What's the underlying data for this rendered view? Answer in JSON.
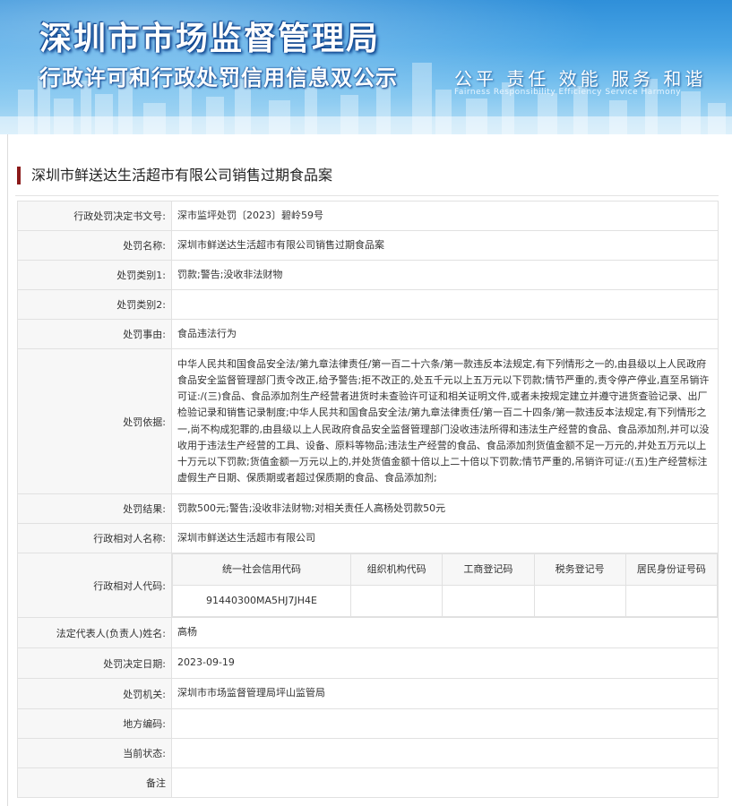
{
  "banner": {
    "title": "深圳市市场监督管理局",
    "subtitle": "行政许可和行政处罚信用信息双公示",
    "slogan": "公平 责任 效能 服务 和谐",
    "slogan_en": "Fairness Responsibility Efficiency Service Harmony"
  },
  "case_title": "深圳市鲜送达生活超市有限公司销售过期食品案",
  "rows": {
    "decision_no": {
      "label": "行政处罚决定书文号:",
      "value": "深市监坪处罚〔2023〕碧岭59号"
    },
    "penalty_name": {
      "label": "处罚名称:",
      "value": "深圳市鲜送达生活超市有限公司销售过期食品案"
    },
    "category1": {
      "label": "处罚类别1:",
      "value": "罚款;警告;没收非法财物"
    },
    "category2": {
      "label": "处罚类别2:",
      "value": ""
    },
    "reason": {
      "label": "处罚事由:",
      "value": "食品违法行为"
    },
    "basis": {
      "label": "处罚依据:",
      "value": "中华人民共和国食品安全法/第九章法律责任/第一百二十六条/第一款违反本法规定,有下列情形之一的,由县级以上人民政府食品安全监督管理部门责令改正,给予警告;拒不改正的,处五千元以上五万元以下罚款;情节严重的,责令停产停业,直至吊销许可证:/(三)食品、食品添加剂生产经营者进货时未查验许可证和相关证明文件,或者未按规定建立并遵守进货查验记录、出厂检验记录和销售记录制度;中华人民共和国食品安全法/第九章法律责任/第一百二十四条/第一款违反本法规定,有下列情形之一,尚不构成犯罪的,由县级以上人民政府食品安全监督管理部门没收违法所得和违法生产经营的食品、食品添加剂,并可以没收用于违法生产经营的工具、设备、原料等物品;违法生产经营的食品、食品添加剂货值金额不足一万元的,并处五万元以上十万元以下罚款;货值金额一万元以上的,并处货值金额十倍以上二十倍以下罚款;情节严重的,吊销许可证:/(五)生产经营标注虚假生产日期、保质期或者超过保质期的食品、食品添加剂;"
    },
    "result": {
      "label": "处罚结果:",
      "value": "罚款500元;警告;没收非法财物;对相关责任人高杨处罚款50元"
    },
    "party_name": {
      "label": "行政相对人名称:",
      "value": "深圳市鲜送达生活超市有限公司"
    },
    "party_code": {
      "label": "行政相对人代码:",
      "headers": [
        "统一社会信用代码",
        "组织机构代码",
        "工商登记码",
        "税务登记号",
        "居民身份证号码"
      ],
      "values": [
        "91440300MA5HJ7JH4E",
        "",
        "",
        "",
        ""
      ]
    },
    "legal_rep": {
      "label": "法定代表人(负责人)姓名:",
      "value": "高杨"
    },
    "decision_date": {
      "label": "处罚决定日期:",
      "value": "2023-09-19"
    },
    "authority": {
      "label": "处罚机关:",
      "value": "深圳市市场监督管理局坪山监管局"
    },
    "region_code": {
      "label": "地方编码:",
      "value": ""
    },
    "status": {
      "label": "当前状态:",
      "value": ""
    },
    "remark": {
      "label": "备注",
      "value": ""
    }
  },
  "colors": {
    "accent_bar": "#8b1a1a",
    "label_bg": "#f7f7f7",
    "border": "#e1e1e1"
  }
}
